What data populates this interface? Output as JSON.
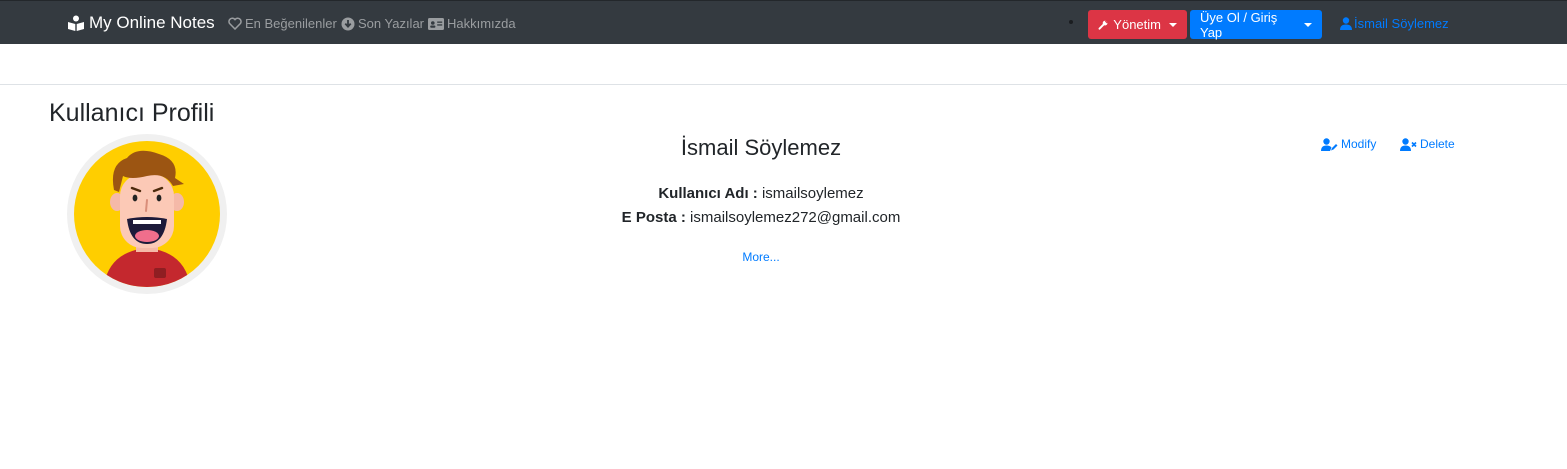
{
  "navbar": {
    "brand": "My Online Notes",
    "links": [
      {
        "label": "En Beğenilenler",
        "icon": "heart-icon"
      },
      {
        "label": "Son Yazılar",
        "icon": "arrow-circle-down-icon"
      },
      {
        "label": "Hakkımızda",
        "icon": "id-card-icon"
      }
    ],
    "admin_button": "Yönetim",
    "auth_button": "Üye Ol / Giriş Yap",
    "user_link": "İsmail Söylemez",
    "colors": {
      "bar": "#343a40",
      "danger": "#dc3545",
      "primary": "#007bff"
    }
  },
  "profile": {
    "page_title": "Kullanıcı Profili",
    "full_name": "İsmail Söylemez",
    "username_label": "Kullanıcı Adı :",
    "username": "ismailsoylemez",
    "email_label": "E Posta :",
    "email": "ismailsoylemez272@gmail.com",
    "more_link": "More...",
    "modify_label": "Modify",
    "delete_label": "Delete"
  }
}
